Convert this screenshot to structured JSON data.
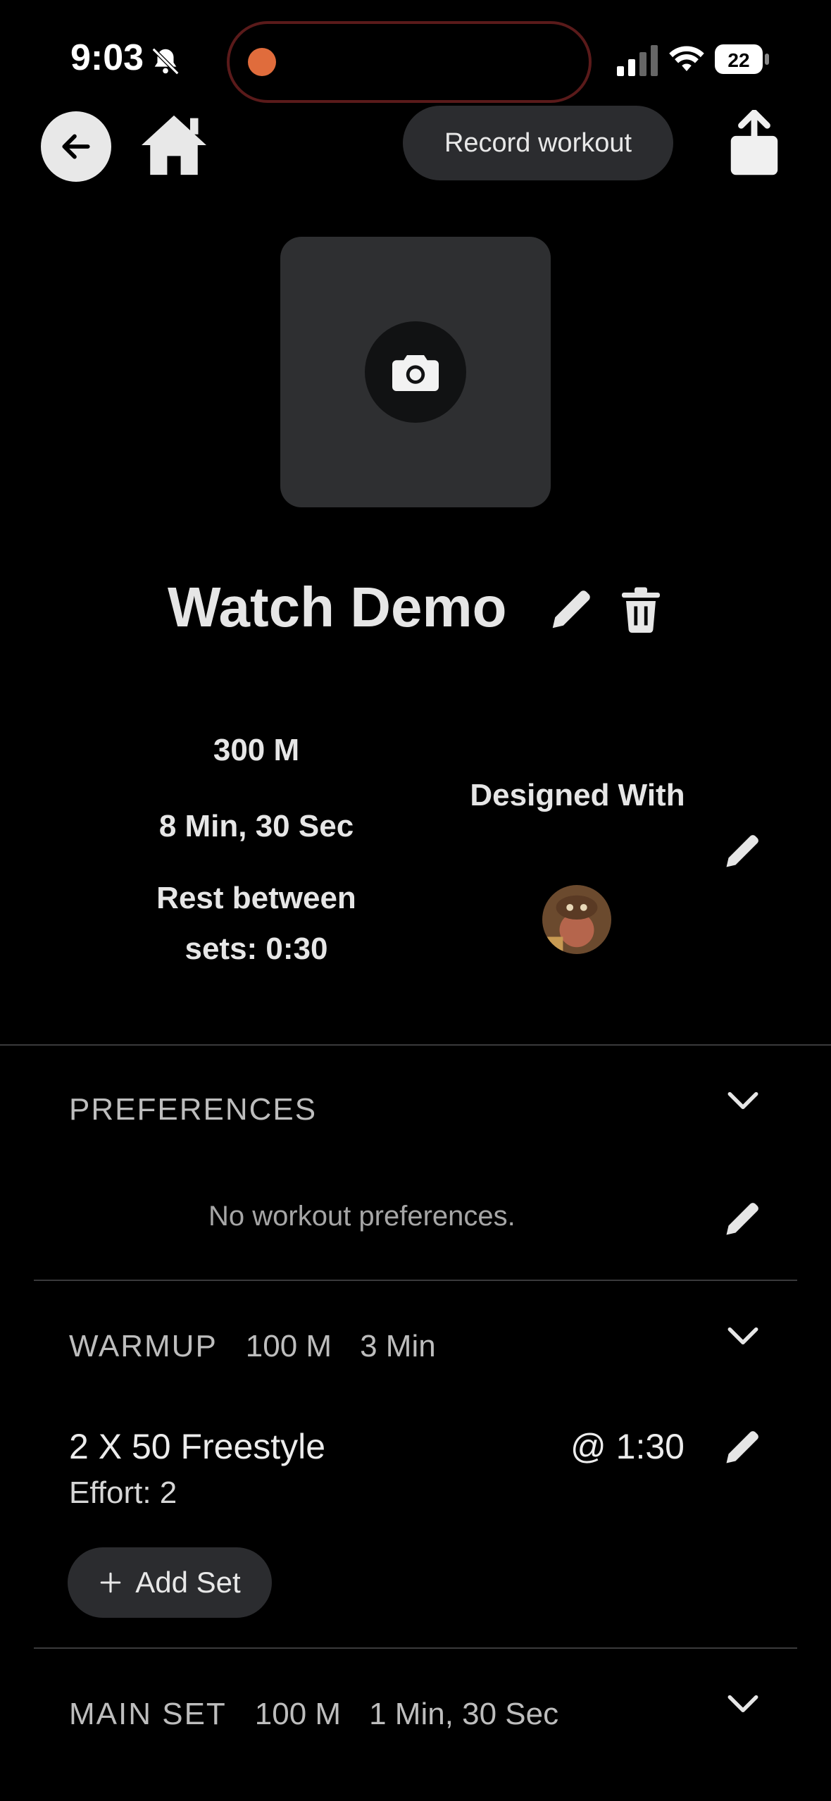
{
  "status_bar": {
    "time": "9:03",
    "battery": "22"
  },
  "nav": {
    "record_label": "Record workout"
  },
  "workout": {
    "title": "Watch Demo",
    "distance": "300 M",
    "duration": "8 Min, 30 Sec",
    "rest_line1": "Rest between",
    "rest_line2": "sets: 0:30",
    "designed_with": "Designed With"
  },
  "preferences": {
    "header": "PREFERENCES",
    "empty_text": "No workout preferences."
  },
  "warmup": {
    "header": "WARMUP",
    "distance": "100 M",
    "time": "3 Min",
    "sets": [
      {
        "name": "2 X 50 Freestyle",
        "effort": "Effort: 2",
        "interval": "@ 1:30"
      }
    ],
    "add_set_label": "Add Set"
  },
  "main_set": {
    "header": "MAIN SET",
    "distance": "100 M",
    "time": "1 Min, 30 Sec"
  },
  "colors": {
    "background": "#000000",
    "pill": "#2b2c2f",
    "photo_box": "#2e2f31",
    "recording_dot": "#e06c3c"
  }
}
